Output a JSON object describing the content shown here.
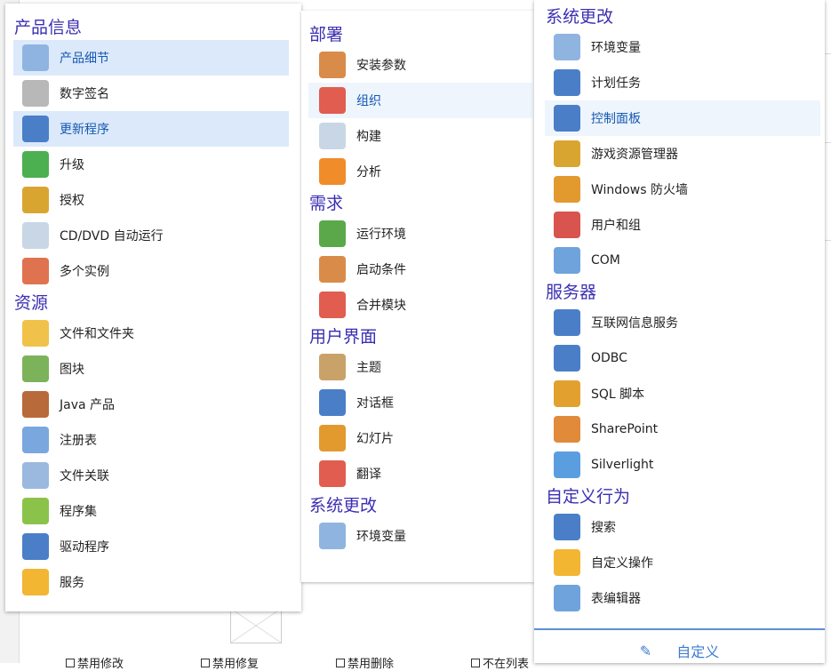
{
  "colors": {
    "header": "#3b2fb2",
    "selected_bg": "#dce9fb",
    "accent": "#3d7bd1"
  },
  "left": {
    "sections": [
      {
        "title": "产品信息",
        "items": [
          {
            "label": "产品细节",
            "icon": "cd-hand-icon",
            "color": "#8fb4e0",
            "selected": true
          },
          {
            "label": "数字签名",
            "icon": "signature-icon",
            "color": "#b8b8b8"
          },
          {
            "label": "更新程序",
            "icon": "globe-update-icon",
            "color": "#4a7fc8",
            "selected": true
          },
          {
            "label": "升级",
            "icon": "upgrade-box-icon",
            "color": "#4caf50"
          },
          {
            "label": "授权",
            "icon": "key-check-icon",
            "color": "#d9a531"
          },
          {
            "label": "CD/DVD 自动运行",
            "icon": "cd-play-icon",
            "color": "#c9d6e6"
          },
          {
            "label": "多个实例",
            "icon": "instances-icon",
            "color": "#e0734f"
          }
        ]
      },
      {
        "title": "资源",
        "items": [
          {
            "label": "文件和文件夹",
            "icon": "folder-icon",
            "color": "#f0c24a"
          },
          {
            "label": "图块",
            "icon": "image-tile-icon",
            "color": "#7cb35a"
          },
          {
            "label": "Java 产品",
            "icon": "java-cup-icon",
            "color": "#b86a3a"
          },
          {
            "label": "注册表",
            "icon": "registry-cubes-icon",
            "color": "#7aa7de"
          },
          {
            "label": "文件关联",
            "icon": "file-association-icon",
            "color": "#9bb9de"
          },
          {
            "label": "程序集",
            "icon": "assembly-blocks-icon",
            "color": "#8bc34a"
          },
          {
            "label": "驱动程序",
            "icon": "usb-driver-icon",
            "color": "#4a7fc8"
          },
          {
            "label": "服务",
            "icon": "service-gear-icon",
            "color": "#f2b632"
          }
        ]
      }
    ]
  },
  "middle": {
    "sections": [
      {
        "title": "部署",
        "items": [
          {
            "label": "安装参数",
            "icon": "install-box-icon",
            "color": "#d98b4a"
          },
          {
            "label": "组织",
            "icon": "organization-icon",
            "color": "#e05d4f",
            "selected": true
          },
          {
            "label": "构建",
            "icon": "build-cd-icon",
            "color": "#c9d6e6"
          },
          {
            "label": "分析",
            "icon": "analysis-chart-icon",
            "color": "#f08c2a"
          }
        ]
      },
      {
        "title": "需求",
        "items": [
          {
            "label": "运行环境",
            "icon": "checklist-icon",
            "color": "#5aa84a"
          },
          {
            "label": "启动条件",
            "icon": "launch-condition-icon",
            "color": "#d98b4a"
          },
          {
            "label": "合并模块",
            "icon": "merge-module-icon",
            "color": "#e05d4f"
          }
        ]
      },
      {
        "title": "用户界面",
        "items": [
          {
            "label": "主题",
            "icon": "palette-icon",
            "color": "#c9a26a"
          },
          {
            "label": "对话框",
            "icon": "dialog-icon",
            "color": "#4a7fc8"
          },
          {
            "label": "幻灯片",
            "icon": "slideshow-icon",
            "color": "#e29a2e"
          },
          {
            "label": "翻译",
            "icon": "translate-icon",
            "color": "#e05d4f"
          }
        ]
      },
      {
        "title": "系统更改",
        "items": [
          {
            "label": "环境变量",
            "icon": "env-variables-icon",
            "color": "#8fb4e0"
          }
        ]
      }
    ]
  },
  "right": {
    "sections": [
      {
        "title": "系统更改",
        "items": [
          {
            "label": "环境变量",
            "icon": "env-variables-icon",
            "color": "#8fb4e0"
          },
          {
            "label": "计划任务",
            "icon": "clock-icon",
            "color": "#4a7fc8"
          },
          {
            "label": "控制面板",
            "icon": "control-panel-icon",
            "color": "#4a7fc8",
            "selected": true
          },
          {
            "label": "游戏资源管理器",
            "icon": "trophy-icon",
            "color": "#d9a531"
          },
          {
            "label": "Windows 防火墙",
            "icon": "firewall-icon",
            "color": "#e29a2e"
          },
          {
            "label": "用户和组",
            "icon": "users-icon",
            "color": "#d9534f"
          },
          {
            "label": "COM",
            "icon": "com-puzzle-icon",
            "color": "#6fa3dc"
          }
        ]
      },
      {
        "title": "服务器",
        "items": [
          {
            "label": "互联网信息服务",
            "icon": "iis-globe-icon",
            "color": "#4a7fc8"
          },
          {
            "label": "ODBC",
            "icon": "odbc-database-icon",
            "color": "#4a7fc8"
          },
          {
            "label": "SQL 脚本",
            "icon": "sql-script-icon",
            "color": "#e2a12e"
          },
          {
            "label": "SharePoint",
            "icon": "sharepoint-icon",
            "color": "#e08a3a"
          },
          {
            "label": "Silverlight",
            "icon": "silverlight-icon",
            "color": "#5b9ee0"
          }
        ]
      },
      {
        "title": "自定义行为",
        "items": [
          {
            "label": "搜索",
            "icon": "search-icon",
            "color": "#4a7fc8"
          },
          {
            "label": "自定义操作",
            "icon": "custom-action-icon",
            "color": "#f2b632"
          },
          {
            "label": "表编辑器",
            "icon": "table-editor-icon",
            "color": "#6fa3dc"
          }
        ]
      }
    ],
    "customize_label": "自定义"
  },
  "background": {
    "checkboxes": [
      "禁用修改",
      "禁用修复",
      "禁用删除",
      "不在列表"
    ]
  }
}
